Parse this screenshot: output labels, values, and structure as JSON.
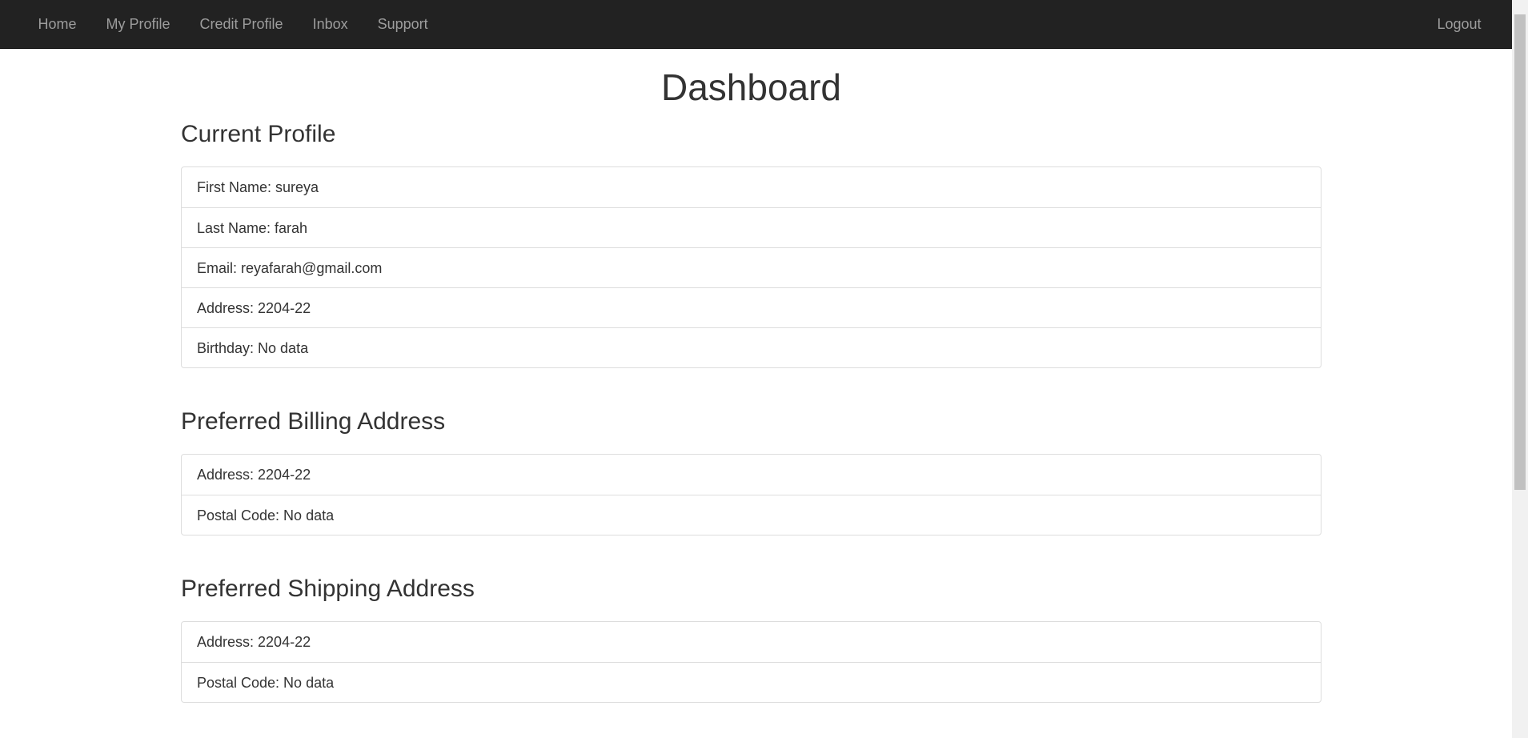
{
  "nav": {
    "items": [
      "Home",
      "My Profile",
      "Credit Profile",
      "Inbox",
      "Support"
    ],
    "logout": "Logout"
  },
  "main": {
    "title": "Dashboard",
    "current_profile": {
      "heading": "Current Profile",
      "rows": [
        "First Name: sureya",
        "Last Name: farah",
        "Email: reyafarah@gmail.com",
        "Address: 2204-22",
        "Birthday: No data"
      ]
    },
    "billing": {
      "heading": "Preferred Billing Address",
      "rows": [
        "Address: 2204-22",
        "Postal Code: No data"
      ]
    },
    "shipping": {
      "heading": "Preferred Shipping Address",
      "rows": [
        "Address: 2204-22",
        "Postal Code: No data"
      ]
    }
  },
  "colors": {
    "navbar_bg": "#222222",
    "nav_link": "#9d9d9d",
    "text": "#333333",
    "border": "#dddddd"
  }
}
